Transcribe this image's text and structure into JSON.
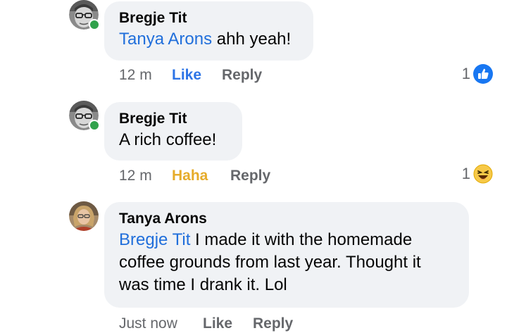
{
  "comments": [
    {
      "author": "Bregje Tit",
      "mention": "Tanya Arons",
      "text": " ahh yeah!",
      "time": "12 m",
      "action1": "Like",
      "action2": "Reply",
      "reaction_count": "1",
      "reaction_icon": "like-icon",
      "online": true
    },
    {
      "author": "Bregje Tit",
      "mention": "",
      "text": "A rich coffee!",
      "time": "12 m",
      "action1": "Haha",
      "action2": "Reply",
      "reaction_count": "1",
      "reaction_icon": "haha-icon",
      "online": true
    },
    {
      "author": "Tanya Arons",
      "mention": "Bregje Tit",
      "text_line1": " I made it with the homemade",
      "text_line2": "coffee grounds from last year.  Thought it",
      "text_line3": "was time I drank it.  Lol",
      "time": "Just now",
      "action1": "Like",
      "action2": "Reply",
      "online": false
    }
  ],
  "colors": {
    "bubble": "#f0f2f5",
    "mention": "#216fdb",
    "like_blue": "#2d74e6",
    "haha_yellow": "#e6ac2b",
    "muted": "#65676b",
    "online_green": "#31a24c"
  }
}
